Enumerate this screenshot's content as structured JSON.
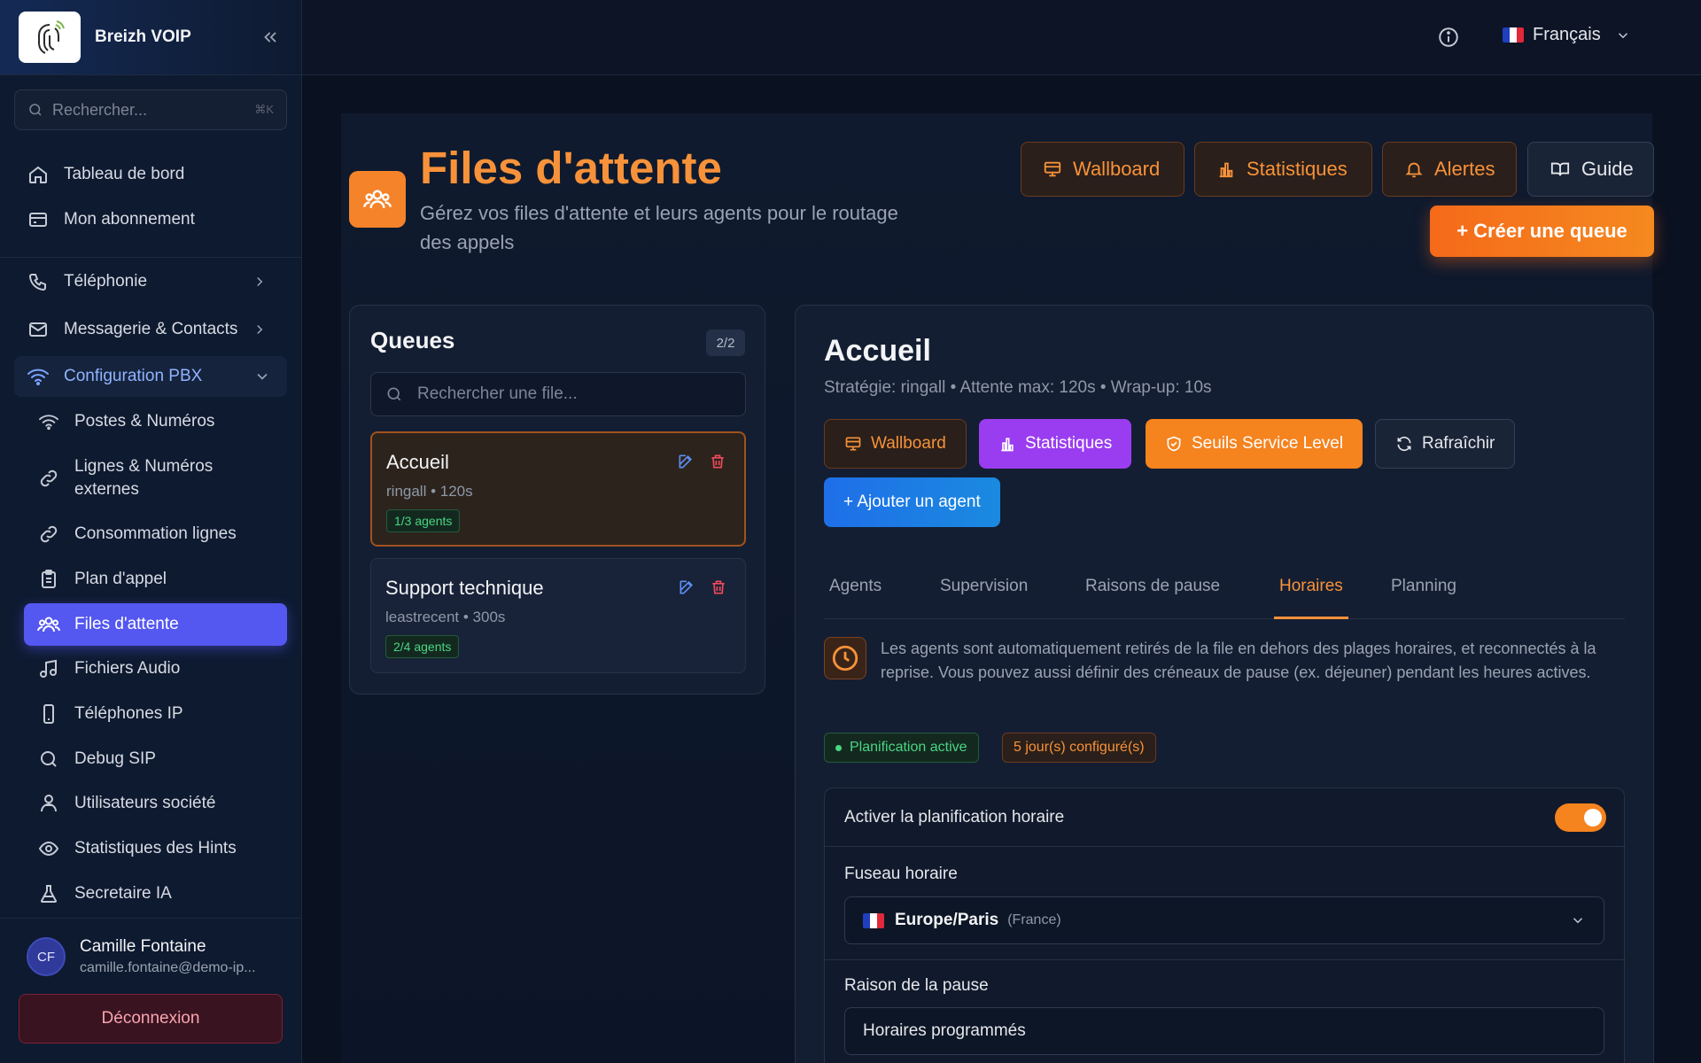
{
  "sidebar": {
    "brand": "Breizh VOIP",
    "search": {
      "placeholder": "Rechercher...",
      "shortcut": "⌘K"
    },
    "items": {
      "dashboard": "Tableau de bord",
      "subscription": "Mon abonnement",
      "telephony": "Téléphonie",
      "messaging": "Messagerie & Contacts",
      "pbx": "Configuration PBX",
      "extensions": "Postes & Numéros",
      "lines": "Lignes & Numéros externes",
      "consumption": "Consommation lignes",
      "dialplan": "Plan d'appel",
      "queues": "Files d'attente",
      "audio": "Fichiers Audio",
      "phones": "Téléphones IP",
      "debug": "Debug SIP",
      "users": "Utilisateurs société",
      "hints": "Statistiques des Hints",
      "ai": "Secretaire IA"
    },
    "user": {
      "initials": "CF",
      "name": "Camille Fontaine",
      "email": "camille.fontaine@demo-ip..."
    },
    "logout": "Déconnexion"
  },
  "topbar": {
    "language": "Français"
  },
  "page": {
    "title": "Files d'attente",
    "subtitle": "Gérez vos files d'attente et leurs agents pour le routage des appels",
    "buttons": {
      "wallboard": "Wallboard",
      "stats": "Statistiques",
      "alerts": "Alertes",
      "guide": "Guide",
      "create": "+ Créer une queue"
    }
  },
  "queues": {
    "title": "Queues",
    "count": "2/2",
    "search_placeholder": "Rechercher une file...",
    "list": [
      {
        "name": "Accueil",
        "meta": "ringall • 120s",
        "agents": "1/3 agents"
      },
      {
        "name": "Support technique",
        "meta": "leastrecent • 300s",
        "agents": "2/4 agents"
      }
    ]
  },
  "detail": {
    "title": "Accueil",
    "subtitle": "Stratégie: ringall • Attente max: 120s • Wrap-up: 10s",
    "buttons": {
      "wallboard": "Wallboard",
      "stats": "Statistiques",
      "seuils": "Seuils Service Level",
      "refresh": "Rafraîchir",
      "add_agent": "+ Ajouter un agent"
    },
    "tabs": [
      "Agents",
      "Supervision",
      "Raisons de pause",
      "Horaires",
      "Planning"
    ],
    "active_tab": "Horaires",
    "info": "Les agents sont automatiquement retirés de la file en dehors des plages horaires, et reconnectés à la reprise. Vous pouvez aussi définir des créneaux de pause (ex. déjeuner) pendant les heures actives.",
    "badges": {
      "active": "Planification active",
      "days": "5 jour(s) configuré(s)"
    },
    "settings": {
      "enable_label": "Activer la planification horaire",
      "enabled": true,
      "timezone_label": "Fuseau horaire",
      "timezone_value": "Europe/Paris",
      "timezone_hint": "(France)",
      "pause_label": "Raison de la pause",
      "pause_value": "Horaires programmés"
    }
  },
  "colors": {
    "accent": "#f7923a",
    "active_nav": "#5457f0",
    "stats": "#9a3df0",
    "success": "#4ad583",
    "danger": "#ef4a5a"
  }
}
